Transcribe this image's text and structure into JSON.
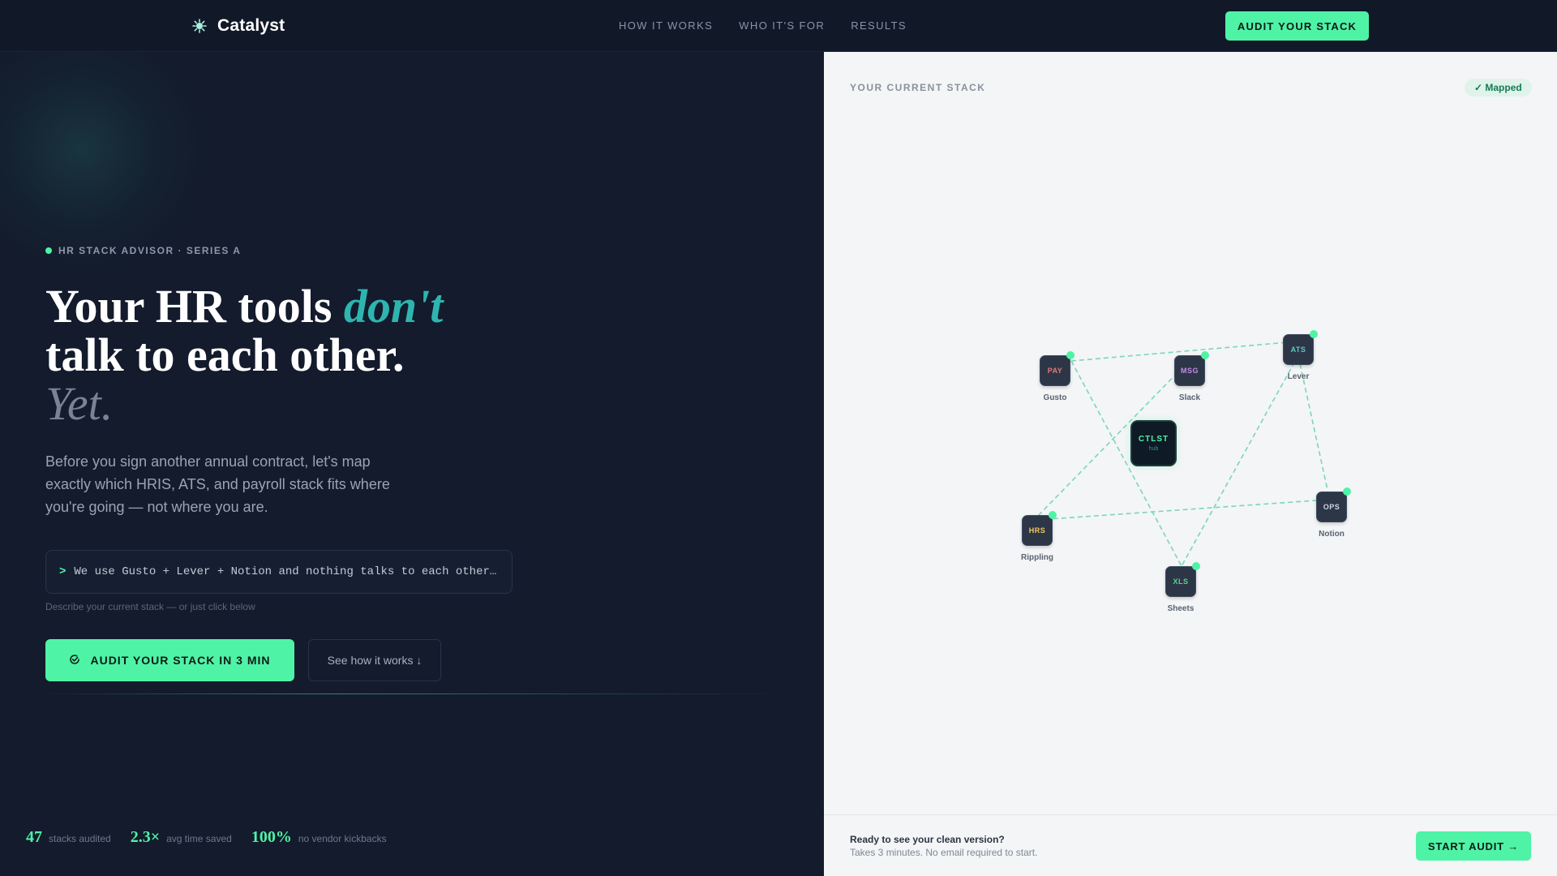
{
  "nav": {
    "brand": "Catalyst",
    "links": [
      "HOW IT WORKS",
      "WHO IT'S FOR",
      "RESULTS"
    ],
    "cta": "AUDIT YOUR STACK"
  },
  "hero": {
    "eyebrow": "HR STACK ADVISOR · SERIES A",
    "headline_part1": "Your HR tools ",
    "headline_accent": "don't",
    "headline_line2": "talk to each other.",
    "headline_line3": "Yet.",
    "subtext": "Before you sign another annual contract, let's map exactly which HRIS, ATS, and payroll stack fits where you're going — not where you are.",
    "prompt_caret": ">",
    "prompt_value": "We use Gusto + Lever + Notion and nothing talks to each other…",
    "prompt_hint": "Describe your current stack — or just click below",
    "primary_cta": "AUDIT YOUR STACK IN 3 MIN",
    "secondary_cta": "See how it works ↓"
  },
  "stats": [
    {
      "value": "47",
      "label": "stacks audited"
    },
    {
      "value": "2.3×",
      "label": "avg time saved"
    },
    {
      "value": "100%",
      "label": "no vendor kickbacks"
    }
  ],
  "panel": {
    "title": "YOUR CURRENT STACK",
    "badge": "✓ Mapped",
    "hub": {
      "name": "CTLST",
      "sub": "hub"
    },
    "nodes": [
      {
        "id": "pay",
        "code": "PAY",
        "name": "Gusto",
        "color": "#e4797b"
      },
      {
        "id": "msg",
        "code": "MSG",
        "name": "Slack",
        "color": "#c48be6"
      },
      {
        "id": "ats",
        "code": "ATS",
        "name": "Lever",
        "color": "#5fc9c0"
      },
      {
        "id": "ops",
        "code": "OPS",
        "name": "Notion",
        "color": "#cfd5de"
      },
      {
        "id": "hrs",
        "code": "HRS",
        "name": "Rippling",
        "color": "#f2cb5c"
      },
      {
        "id": "xls",
        "code": "XLS",
        "name": "Sheets",
        "color": "#5fd18f"
      }
    ],
    "footer_title": "Ready to see your clean version?",
    "footer_sub": "Takes 3 minutes. No email required to start.",
    "footer_cta": "START AUDIT →"
  },
  "colors": {
    "accent": "#4ff3a6",
    "headline_accent": "#2fb5b0",
    "background": "#131b2c",
    "panel_background": "#f3f5f7"
  },
  "icons": {
    "brand": "gear-burst-icon",
    "primary_cta": "check-circle-icon"
  }
}
